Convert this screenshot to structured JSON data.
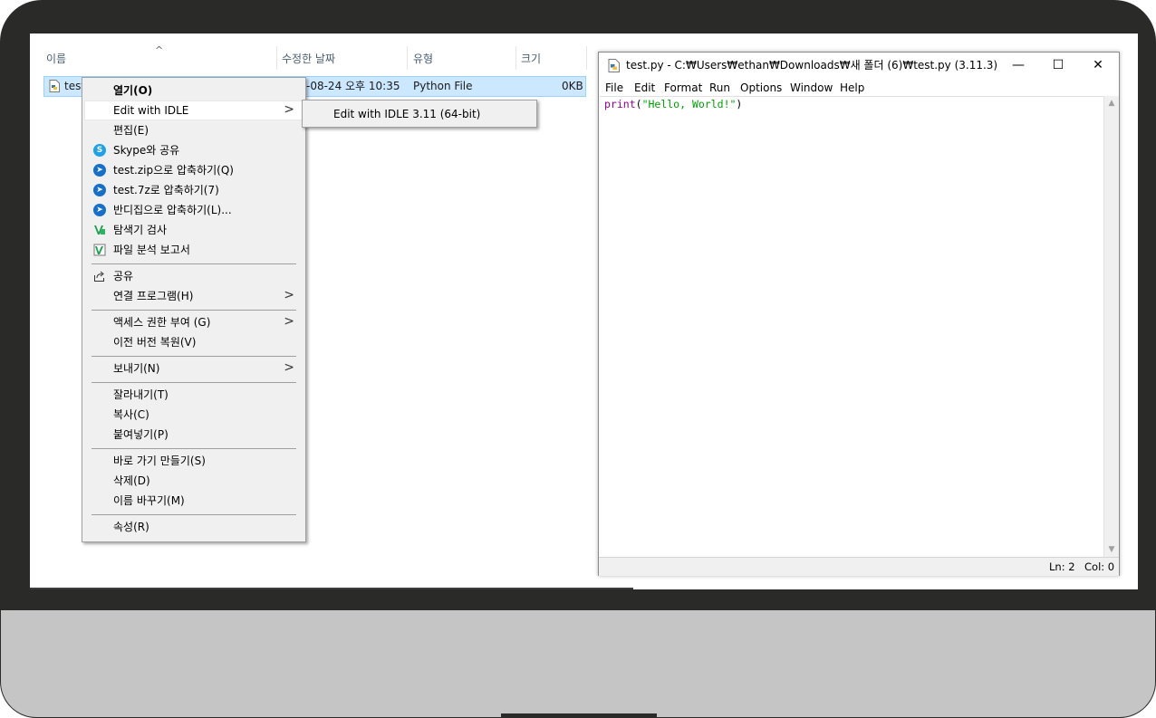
{
  "explorer": {
    "columns": {
      "name": "이름",
      "date": "수정한 날짜",
      "type": "유형",
      "size": "크기"
    },
    "file": {
      "name": "test",
      "date": "-08-24 오후 10:35",
      "type": "Python File",
      "size": "0KB"
    }
  },
  "context_menu": {
    "items": [
      {
        "label": "열기(O)"
      },
      {
        "label": "Edit with IDLE"
      },
      {
        "label": "편집(E)"
      },
      {
        "label": "Skype와 공유",
        "icon": "skype-icon"
      },
      {
        "label": "test.zip으로 압축하기(Q)",
        "icon": "bandizip-icon"
      },
      {
        "label": "test.7z로 압축하기(7)",
        "icon": "bandizip-icon"
      },
      {
        "label": "반디집으로 압축하기(L)...",
        "icon": "bandizip-icon"
      },
      {
        "label": "탐색기 검사",
        "icon": "v3-icon"
      },
      {
        "label": "파일 분석 보고서",
        "icon": "v3-icon"
      },
      {
        "label": "공유",
        "icon": "share-icon"
      },
      {
        "label": "연결 프로그램(H)"
      },
      {
        "label": "액세스 권한 부여 (G)"
      },
      {
        "label": "이전 버전 복원(V)"
      },
      {
        "label": "보내기(N)"
      },
      {
        "label": "잘라내기(T)"
      },
      {
        "label": "복사(C)"
      },
      {
        "label": "붙여넣기(P)"
      },
      {
        "label": "바로 가기 만들기(S)"
      },
      {
        "label": "삭제(D)"
      },
      {
        "label": "이름 바꾸기(M)"
      },
      {
        "label": "속성(R)"
      }
    ],
    "submenu": {
      "items": [
        {
          "label": "Edit with IDLE 3.11 (64-bit)"
        }
      ]
    }
  },
  "idle": {
    "title": "test.py - C:₩Users₩ethan₩Downloads₩새 폴더 (6)₩test.py (3.11.3)",
    "window_buttons": {
      "minimize": "—",
      "maximize": "☐",
      "close": "✕"
    },
    "menus": [
      "File",
      "Edit",
      "Format",
      "Run",
      "Options",
      "Window",
      "Help"
    ],
    "code": {
      "func": "print",
      "open": "(",
      "string": "\"Hello, World!\"",
      "close": ")"
    },
    "status": {
      "line": "Ln: 2",
      "col": "Col: 0"
    }
  },
  "colors": {
    "selection": "#cce8ff",
    "menu_bg": "#f0f0f0",
    "keyword": "#900090",
    "string": "#00a000",
    "bezel": "#2a2a29",
    "chin": "#c4c5c4"
  }
}
